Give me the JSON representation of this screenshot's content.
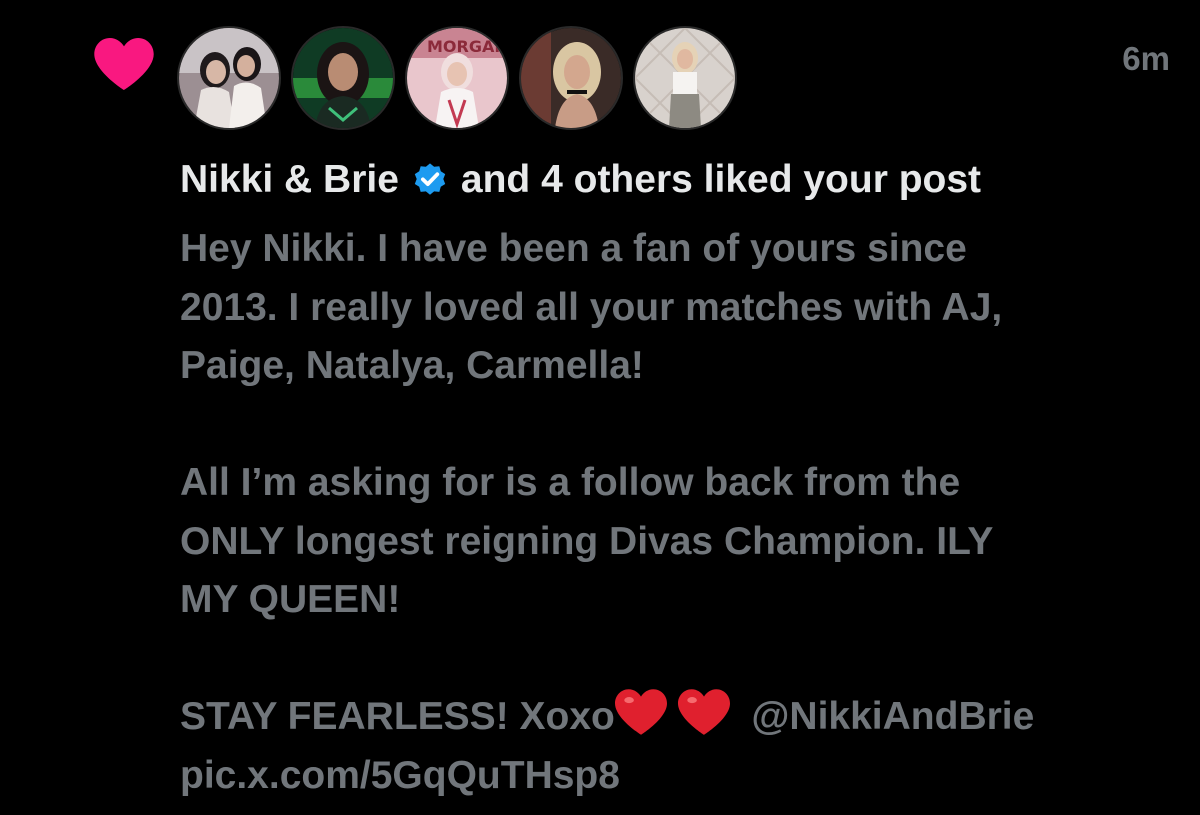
{
  "notification": {
    "type_icon": "heart-icon",
    "timestamp": "6m",
    "avatars": [
      {
        "name": "Nikki & Brie",
        "icon": "avatar-photo"
      },
      {
        "name": "liker-2",
        "icon": "avatar-photo"
      },
      {
        "name": "liker-3",
        "icon": "avatar-photo"
      },
      {
        "name": "liker-4",
        "icon": "avatar-photo"
      },
      {
        "name": "liker-5",
        "icon": "avatar-photo"
      }
    ],
    "actor_name": "Nikki & Brie",
    "verified_icon": "verified-badge-icon",
    "action_text": "and 4 others liked your post",
    "post": {
      "line1": "Hey Nikki. I have been a fan of yours since",
      "line2": "2013. I really loved all your matches with AJ,",
      "line3": "Paige, Natalya, Carmella!",
      "line4": "All I’m asking for is a follow back from the",
      "line5": "ONLY longest reigning Divas Champion. ILY",
      "line6": "MY QUEEN!",
      "line7_text": "STAY FEARLESS! Xoxo",
      "line7_emoji": "red-heart-emoji",
      "line7_mention": "@NikkiAndBrie",
      "line8": "pic.x.com/5GqQuTHsp8"
    }
  },
  "colors": {
    "background": "#000000",
    "primary_text": "#e7e9ea",
    "secondary_text": "#71767b",
    "like_pink": "#f91880",
    "verified_blue": "#1d9bf0",
    "emoji_red": "#e0202e"
  }
}
